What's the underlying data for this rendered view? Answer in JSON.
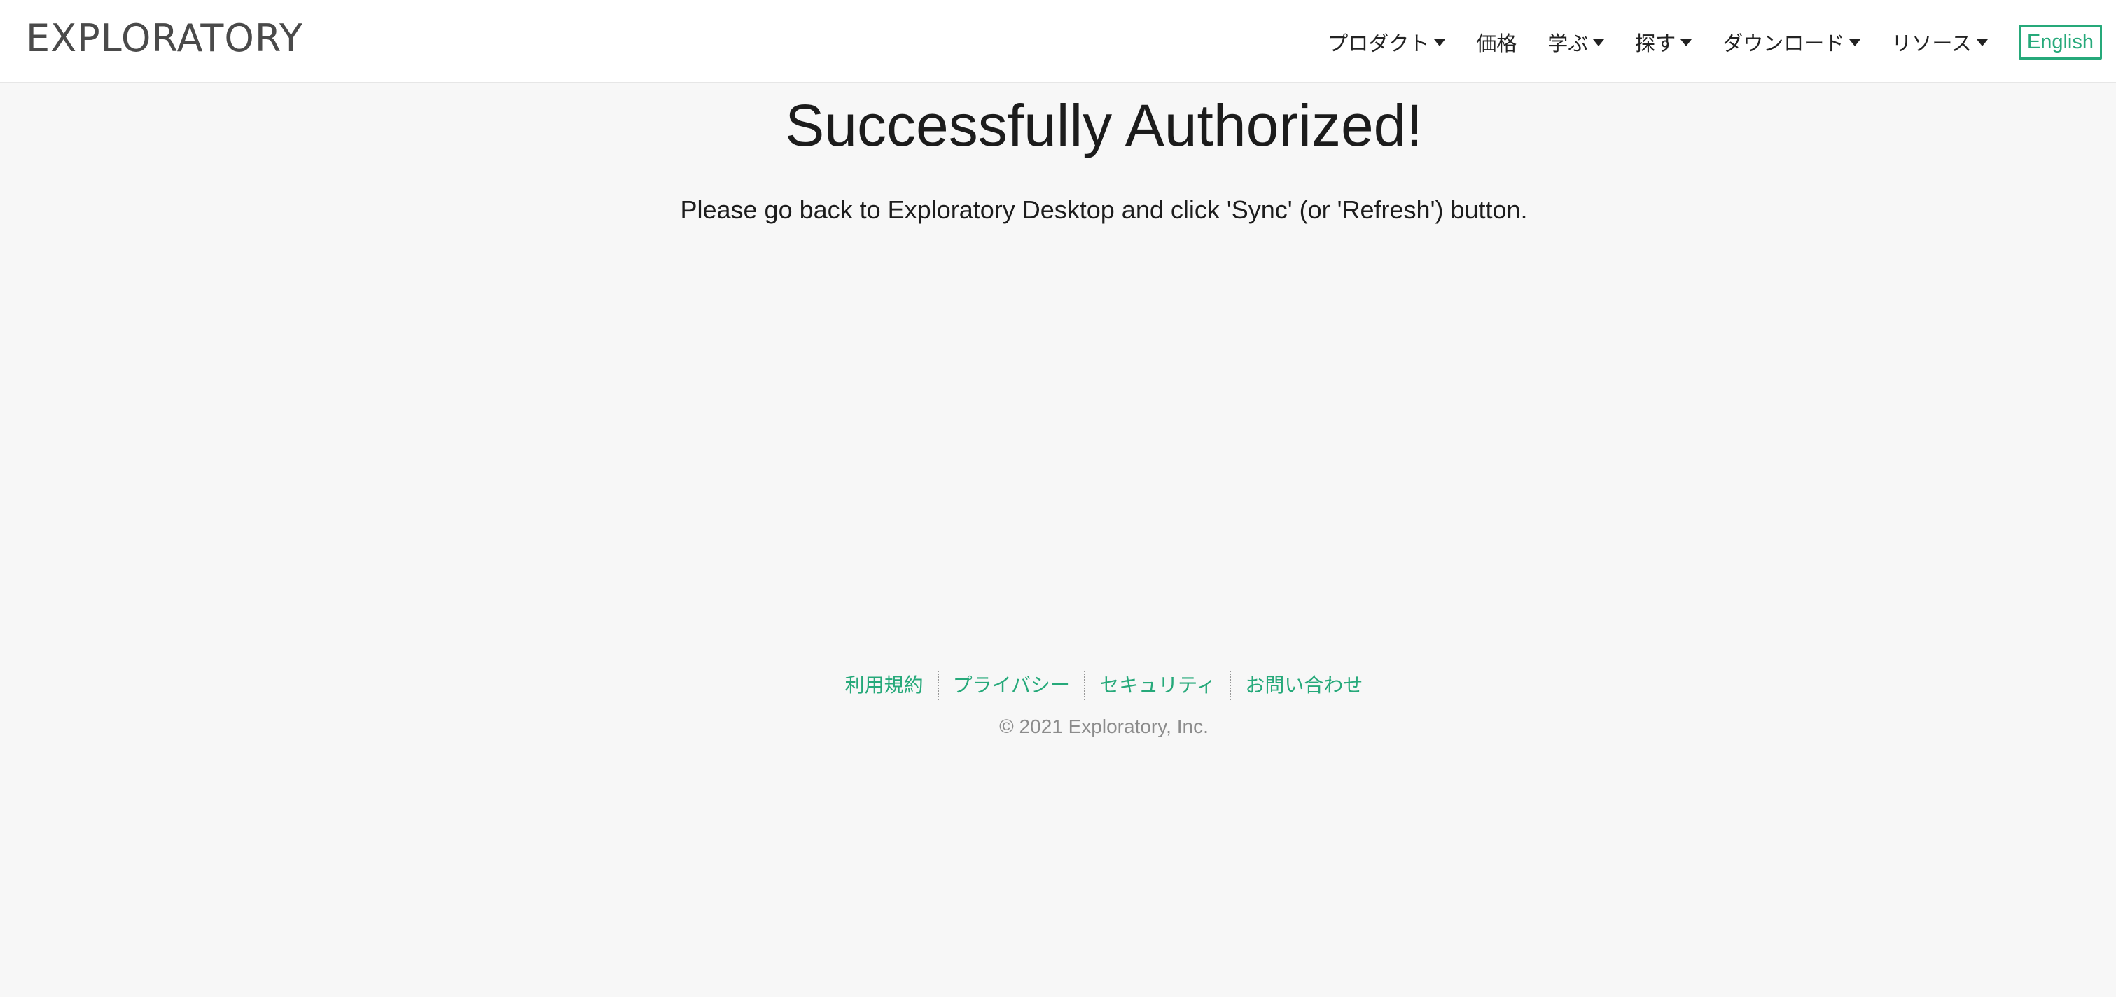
{
  "header": {
    "logo": "EXPLORATORY",
    "nav": [
      {
        "label": "プロダクト",
        "dropdown": true
      },
      {
        "label": "価格",
        "dropdown": false
      },
      {
        "label": "学ぶ",
        "dropdown": true
      },
      {
        "label": "探す",
        "dropdown": true
      },
      {
        "label": "ダウンロード",
        "dropdown": true
      },
      {
        "label": "リソース",
        "dropdown": true
      }
    ],
    "language_button": "English"
  },
  "main": {
    "title": "Successfully Authorized!",
    "message": "Please go back to Exploratory Desktop and click 'Sync' (or 'Refresh') button."
  },
  "footer": {
    "links": [
      {
        "label": "利用規約"
      },
      {
        "label": "プライバシー"
      },
      {
        "label": "セキュリティ"
      },
      {
        "label": "お問い合わせ"
      }
    ],
    "copyright": "© 2021 Exploratory, Inc."
  },
  "colors": {
    "accent": "#26a97a",
    "background": "#f7f7f7",
    "header_background": "#ffffff",
    "text": "#1c1c1c",
    "muted_text": "#8c8c8c"
  }
}
